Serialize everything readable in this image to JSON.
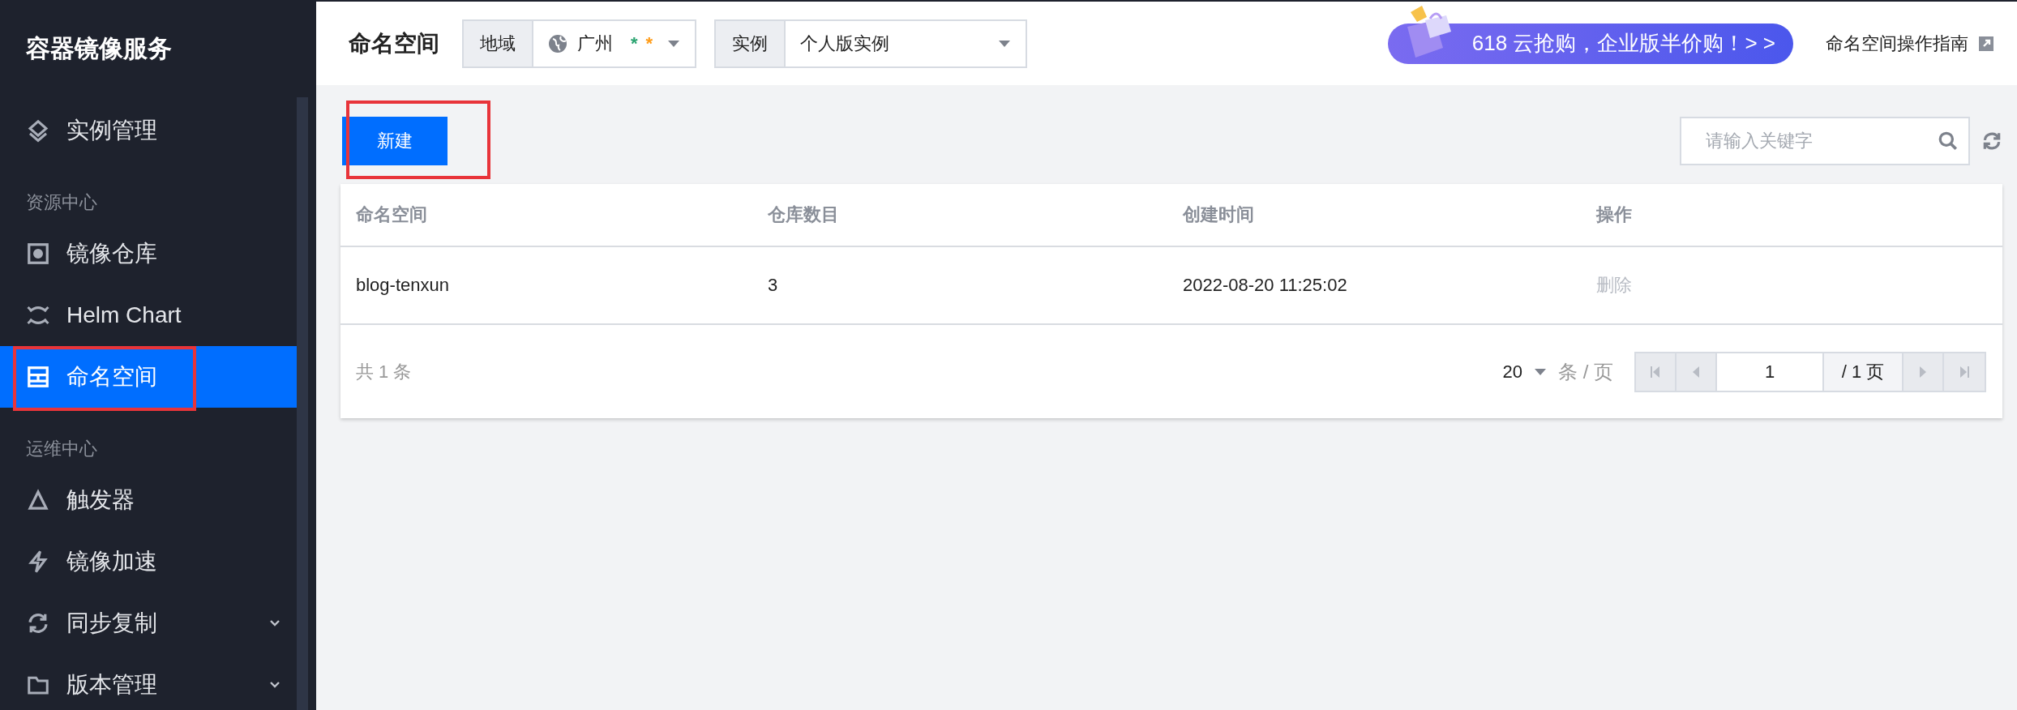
{
  "sidebar": {
    "title": "容器镜像服务",
    "items": [
      {
        "kind": "item",
        "label": "实例管理",
        "selected": false,
        "expandable": false,
        "highlighted": false
      },
      {
        "kind": "group",
        "label": "资源中心"
      },
      {
        "kind": "item",
        "label": "镜像仓库",
        "selected": false,
        "expandable": false,
        "highlighted": false
      },
      {
        "kind": "item",
        "label": "Helm Chart",
        "selected": false,
        "expandable": false,
        "highlighted": false
      },
      {
        "kind": "item",
        "label": "命名空间",
        "selected": true,
        "expandable": false,
        "highlighted": true
      },
      {
        "kind": "group",
        "label": "运维中心"
      },
      {
        "kind": "item",
        "label": "触发器",
        "selected": false,
        "expandable": false,
        "highlighted": false
      },
      {
        "kind": "item",
        "label": "镜像加速",
        "selected": false,
        "expandable": false,
        "highlighted": false
      },
      {
        "kind": "item",
        "label": "同步复制",
        "selected": false,
        "expandable": true,
        "highlighted": false
      },
      {
        "kind": "item",
        "label": "版本管理",
        "selected": false,
        "expandable": true,
        "highlighted": false
      }
    ]
  },
  "header": {
    "title": "命名空间",
    "region": {
      "label": "地域",
      "value": "广州",
      "marks": [
        {
          "text": "*",
          "color": "#2ba471"
        },
        {
          "text": "*",
          "color": "#ff9c19"
        }
      ]
    },
    "instance": {
      "label": "实例",
      "value": "个人版实例"
    },
    "promo": "618 云抢购，企业版半价购！> >",
    "guide": "命名空间操作指南"
  },
  "toolbar": {
    "new_button": {
      "label": "新建",
      "highlighted": true
    },
    "search": {
      "placeholder": "请输入关键字"
    }
  },
  "table": {
    "columns": [
      "命名空间",
      "仓库数目",
      "创建时间",
      "操作"
    ],
    "rows": [
      {
        "cells": [
          "blog-tenxun",
          "3",
          "2022-08-20 11:25:02"
        ],
        "action": {
          "label": "删除",
          "disabled": true
        }
      }
    ],
    "footer": {
      "total": "共 1 条",
      "page_size": "20",
      "per_page": "条 / 页",
      "page": "1",
      "page_total": "/ 1 页"
    }
  }
}
